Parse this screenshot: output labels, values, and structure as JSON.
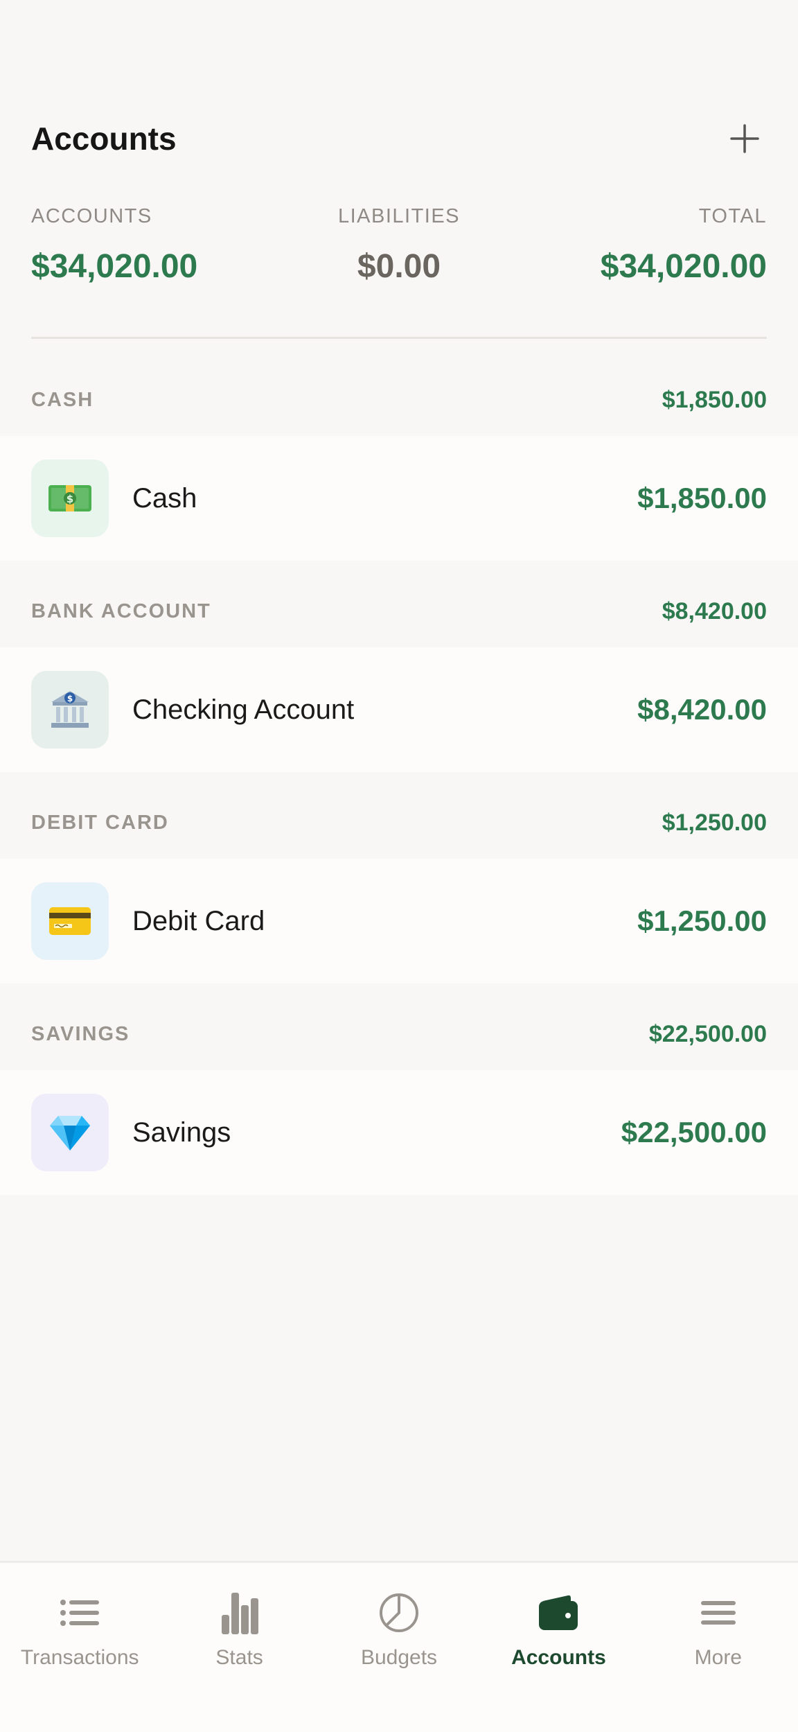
{
  "header": {
    "title": "Accounts",
    "add_icon": "plus-icon"
  },
  "summary": [
    {
      "label": "ACCOUNTS",
      "value": "$34,020.00",
      "color": "#2d7a4f"
    },
    {
      "label": "LIABILITIES",
      "value": "$0.00",
      "color": "#6b6560"
    },
    {
      "label": "TOTAL",
      "value": "$34,020.00",
      "color": "#2d7a4f"
    }
  ],
  "groups": [
    {
      "name": "CASH",
      "total": "$1,850.00",
      "account": {
        "name": "Cash",
        "amount": "$1,850.00",
        "icon": "money-bill-icon",
        "icon_bg": "#e8f5ec"
      }
    },
    {
      "name": "BANK ACCOUNT",
      "total": "$8,420.00",
      "account": {
        "name": "Checking Account",
        "amount": "$8,420.00",
        "icon": "bank-icon",
        "icon_bg": "#e6efec"
      }
    },
    {
      "name": "DEBIT CARD",
      "total": "$1,250.00",
      "account": {
        "name": "Debit Card",
        "amount": "$1,250.00",
        "icon": "credit-card-icon",
        "icon_bg": "#e6f2f9"
      }
    },
    {
      "name": "SAVINGS",
      "total": "$22,500.00",
      "account": {
        "name": "Savings",
        "amount": "$22,500.00",
        "icon": "gem-icon",
        "icon_bg": "#efedf9"
      }
    }
  ],
  "nav": [
    {
      "label": "Transactions",
      "icon": "list-icon",
      "active": false
    },
    {
      "label": "Stats",
      "icon": "bar-chart-icon",
      "active": false
    },
    {
      "label": "Budgets",
      "icon": "pie-chart-icon",
      "active": false
    },
    {
      "label": "Accounts",
      "icon": "wallet-icon",
      "active": true
    },
    {
      "label": "More",
      "icon": "menu-icon",
      "active": false
    }
  ],
  "colors": {
    "accent": "#2d7a4f",
    "nav_active": "#1d4a2f",
    "nav_inactive": "#9a948e"
  }
}
